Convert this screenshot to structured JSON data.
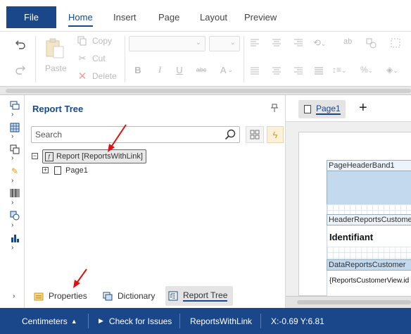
{
  "menu": {
    "file_label": "File",
    "tabs": [
      {
        "label": "Home"
      },
      {
        "label": "Insert"
      },
      {
        "label": "Page"
      },
      {
        "label": "Layout"
      },
      {
        "label": "Preview"
      }
    ]
  },
  "ribbon": {
    "paste_label": "Paste",
    "copy_label": "Copy",
    "cut_label": "Cut",
    "delete_label": "Delete"
  },
  "panel": {
    "title": "Report Tree",
    "search_placeholder": "Search",
    "tree_root_label": "Report [ReportsWithLink]",
    "tree_page_label": "Page1",
    "bottom_tabs": [
      {
        "label": "Properties"
      },
      {
        "label": "Dictionary"
      },
      {
        "label": "Report Tree"
      }
    ]
  },
  "designer": {
    "page_tab": "Page1",
    "bands": {
      "page_header": "PageHeaderBand1",
      "header_reports": "HeaderReportsCustomer",
      "identifiant": "Identifiant",
      "data_reports": "DataReportsCustomer",
      "data_text": "{ReportsCustomerView.id"
    }
  },
  "status": {
    "units": "Centimeters",
    "check_issues": "Check for Issues",
    "report_name": "ReportsWithLink",
    "coords": "X:-0.69 Y:6.81"
  },
  "colors": {
    "brand": "#19478a",
    "annotation_arrow": "#e01010",
    "page_header_band": "#c3d9ee",
    "flash_icon": "#e39a00"
  }
}
